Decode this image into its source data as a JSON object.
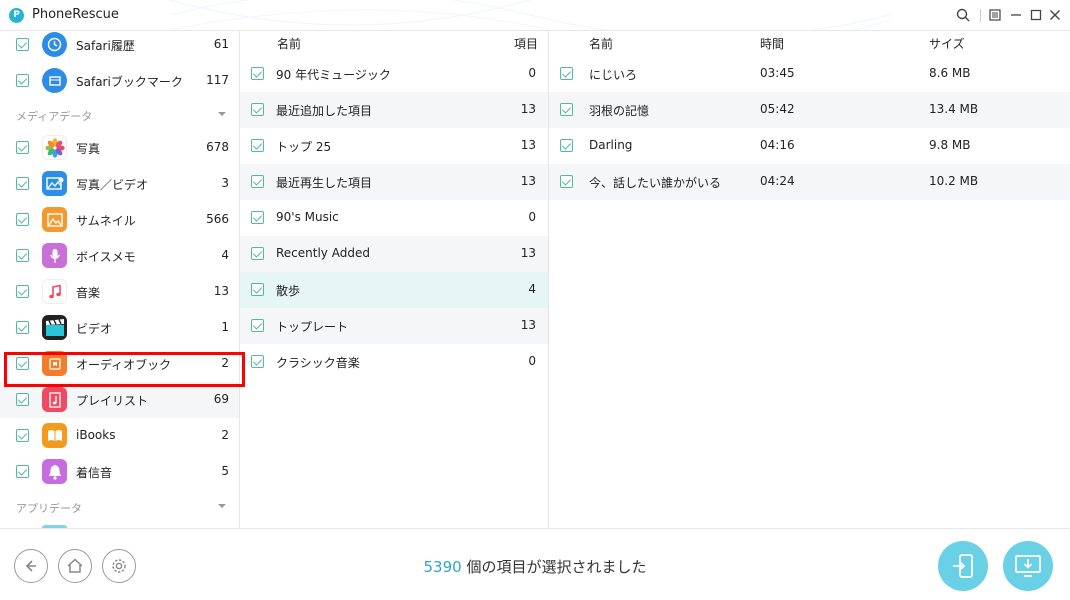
{
  "app": {
    "title": "PhoneRescue",
    "logo_letter": "P"
  },
  "sidebar": {
    "items_top": [
      {
        "label": "Safari履歴",
        "count": "61",
        "icon": "safari-history-icon"
      },
      {
        "label": "Safariブックマーク",
        "count": "117",
        "icon": "safari-bookmark-icon"
      }
    ],
    "section_media": "メディアデータ",
    "items_media": [
      {
        "label": "写真",
        "count": "678",
        "icon": "photos-icon"
      },
      {
        "label": "写真／ビデオ",
        "count": "3",
        "icon": "photo-video-icon"
      },
      {
        "label": "サムネイル",
        "count": "566",
        "icon": "thumbnail-icon"
      },
      {
        "label": "ボイスメモ",
        "count": "4",
        "icon": "voice-memo-icon"
      },
      {
        "label": "音楽",
        "count": "13",
        "icon": "music-icon"
      },
      {
        "label": "ビデオ",
        "count": "1",
        "icon": "video-icon"
      },
      {
        "label": "オーディオブック",
        "count": "2",
        "icon": "audiobook-icon"
      },
      {
        "label": "プレイリスト",
        "count": "69",
        "icon": "playlist-icon"
      },
      {
        "label": "iBooks",
        "count": "2",
        "icon": "ibooks-icon"
      },
      {
        "label": "着信音",
        "count": "5",
        "icon": "ringtone-icon"
      }
    ],
    "section_app": "アプリデータ"
  },
  "playlists": {
    "header_name": "名前",
    "header_items": "項目",
    "rows": [
      {
        "name": "90 年代ミュージック",
        "count": "0"
      },
      {
        "name": "最近追加した項目",
        "count": "13"
      },
      {
        "name": "トップ 25",
        "count": "13"
      },
      {
        "name": "最近再生した項目",
        "count": "13"
      },
      {
        "name": "90's Music",
        "count": "0"
      },
      {
        "name": "Recently Added",
        "count": "13"
      },
      {
        "name": "散歩",
        "count": "4"
      },
      {
        "name": "トップレート",
        "count": "13"
      },
      {
        "name": "クラシック音楽",
        "count": "0"
      }
    ]
  },
  "songs": {
    "header_name": "名前",
    "header_time": "時間",
    "header_size": "サイズ",
    "rows": [
      {
        "name": "にじいろ",
        "time": "03:45",
        "size": "8.6 MB"
      },
      {
        "name": "羽根の記憶",
        "time": "05:42",
        "size": "13.4 MB"
      },
      {
        "name": "Darling",
        "time": "04:16",
        "size": "9.8 MB"
      },
      {
        "name": "今、話したい誰かがいる",
        "time": "04:24",
        "size": "10.2 MB"
      }
    ]
  },
  "status": {
    "count": "5390",
    "text": " 個の項目が選択されました"
  },
  "colors": {
    "accent": "#2aa6c6",
    "check": "#52b9a0",
    "highlight": "#ff0000",
    "button": "#6ad0e6"
  }
}
